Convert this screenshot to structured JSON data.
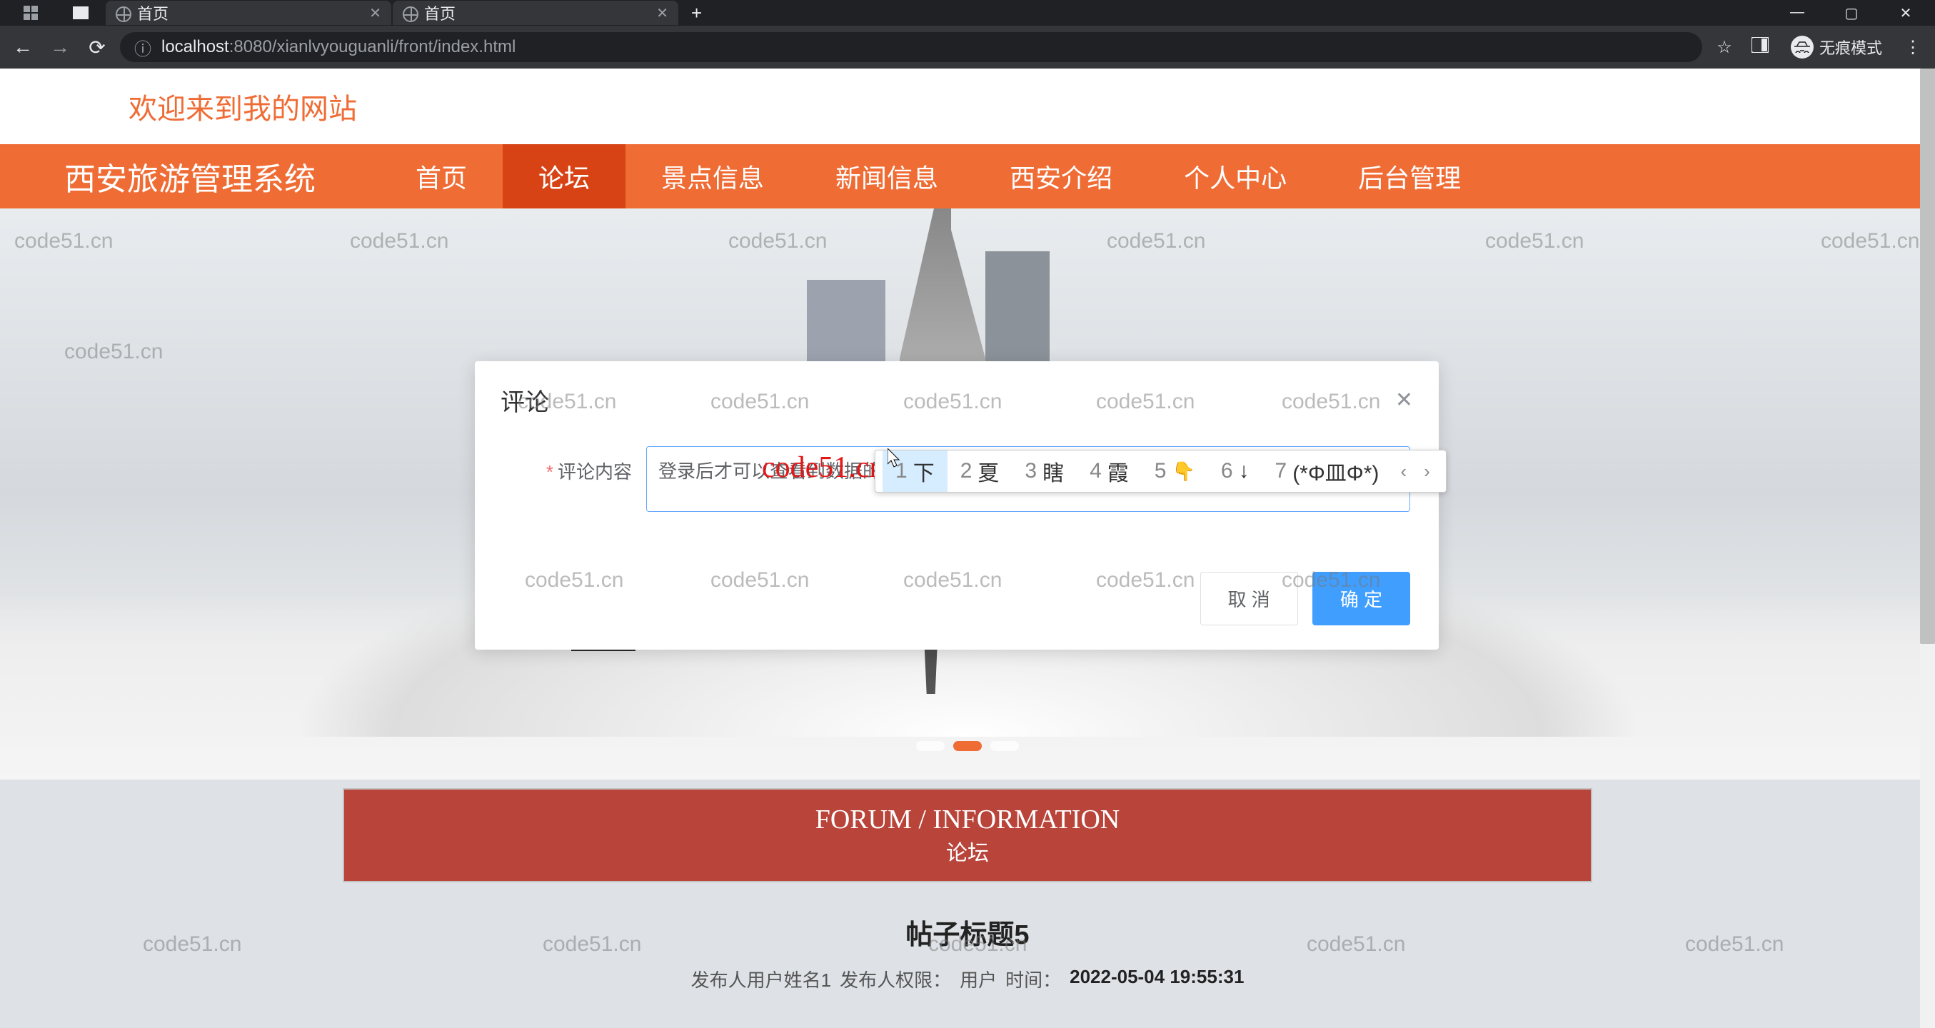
{
  "browser": {
    "tabs": [
      {
        "title": "首页"
      },
      {
        "title": "首页"
      }
    ],
    "url_protocol": "localhost",
    "url_port": ":8080",
    "url_path": "/xianlvyouguanli/front/index.html",
    "incognito_label": "无痕模式"
  },
  "page": {
    "welcome": "欢迎来到我的网站",
    "brand": "西安旅游管理系统",
    "nav": [
      "首页",
      "论坛",
      "景点信息",
      "新闻信息",
      "西安介绍",
      "个人中心",
      "后台管理"
    ],
    "nav_active_index": 1,
    "watermark": "code51.cn",
    "red_watermark": "code51.cn-源码乐园盗图必究",
    "forum_banner_title": "FORUM / INFORMATION",
    "forum_banner_sub": "论坛",
    "post_title": "帖子标题5",
    "post_meta": {
      "publisher_label": "发布人用户姓名1",
      "role_label": "发布人权限：",
      "role_value": "用户",
      "time_label": "时间：",
      "time_value": "2022-05-04 19:55:31"
    }
  },
  "modal": {
    "title": "评论",
    "field_label": "评论内容",
    "textarea_value": "登录后才可以查看到数据的xia",
    "cancel": "取 消",
    "confirm": "确 定"
  },
  "ime": {
    "candidates": [
      {
        "n": "1",
        "text": "下"
      },
      {
        "n": "2",
        "text": "夏"
      },
      {
        "n": "3",
        "text": "瞎"
      },
      {
        "n": "4",
        "text": "霞"
      },
      {
        "n": "5",
        "text": "👇"
      },
      {
        "n": "6",
        "text": "↓"
      },
      {
        "n": "7",
        "text": "(*Φ皿Φ*)"
      }
    ]
  }
}
